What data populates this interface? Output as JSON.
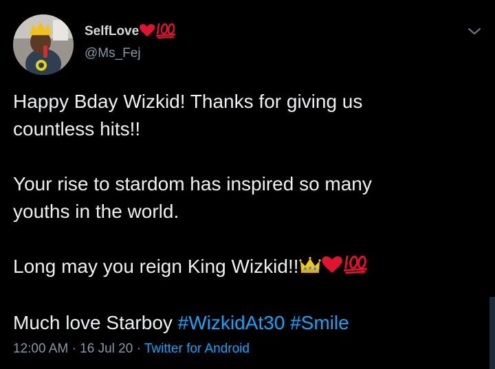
{
  "tweet": {
    "author": {
      "display_name": "SelfLove",
      "display_name_emojis": [
        "heart-emoji",
        "hundred-points-emoji"
      ],
      "handle": "@Ms_Fej"
    },
    "text": {
      "line_1": "Happy Bday Wizkid! Thanks for giving us",
      "line_2": "countless hits!!",
      "line_3": "Your rise to stardom has inspired so many",
      "line_4": "youths in the world.",
      "line_5": "Long may you reign King Wizkid!!",
      "line_5_emojis": [
        "crown-emoji",
        "heart-emoji",
        "hundred-points-emoji"
      ],
      "line_6_prefix": "Much love Starboy",
      "hashtag_1": "#WizkidAt30",
      "hashtag_2": "#Smile"
    },
    "meta": {
      "time": "12:00 AM",
      "separator": "·",
      "date": "16 Jul 20",
      "source": "Twitter for Android"
    }
  },
  "colors": {
    "background": "#000000",
    "link": "#1da1f2",
    "secondary_text": "#8899a6",
    "heart": "#e0142f"
  },
  "icons": {
    "menu": "chevron-down-icon"
  }
}
